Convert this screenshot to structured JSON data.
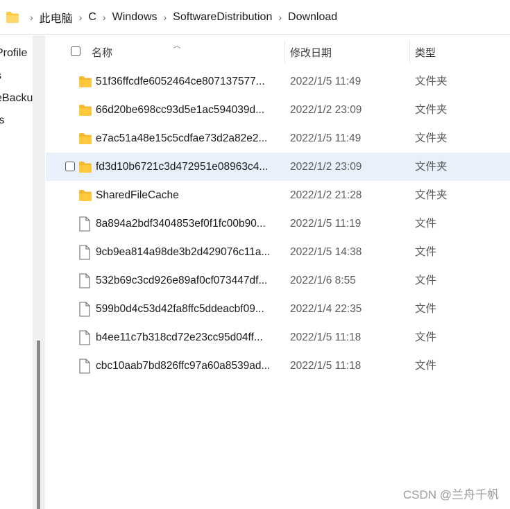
{
  "breadcrumb": {
    "items": [
      "此电脑",
      "C",
      "Windows",
      "SoftwareDistribution",
      "Download"
    ]
  },
  "nav": {
    "items": [
      "Profile",
      "s",
      "eBacku",
      "ts"
    ]
  },
  "header": {
    "name": "名称",
    "modified": "修改日期",
    "type": "类型"
  },
  "files": [
    {
      "name": "51f36ffcdfe6052464ce807137577...",
      "date": "2022/1/5 11:49",
      "type": "文件夹",
      "kind": "folder"
    },
    {
      "name": "66d20be698cc93d5e1ac594039d...",
      "date": "2022/1/2 23:09",
      "type": "文件夹",
      "kind": "folder"
    },
    {
      "name": "e7ac51a48e15c5cdfae73d2a82e2...",
      "date": "2022/1/5 11:49",
      "type": "文件夹",
      "kind": "folder"
    },
    {
      "name": "fd3d10b6721c3d472951e08963c4...",
      "date": "2022/1/2 23:09",
      "type": "文件夹",
      "kind": "folder",
      "hover": true
    },
    {
      "name": "SharedFileCache",
      "date": "2022/1/2 21:28",
      "type": "文件夹",
      "kind": "folder"
    },
    {
      "name": "8a894a2bdf3404853ef0f1fc00b90...",
      "date": "2022/1/5 11:19",
      "type": "文件",
      "kind": "file"
    },
    {
      "name": "9cb9ea814a98de3b2d429076c11a...",
      "date": "2022/1/5 14:38",
      "type": "文件",
      "kind": "file"
    },
    {
      "name": "532b69c3cd926e89af0cf073447df...",
      "date": "2022/1/6 8:55",
      "type": "文件",
      "kind": "file"
    },
    {
      "name": "599b0d4c53d42fa8ffc5ddeacbf09...",
      "date": "2022/1/4 22:35",
      "type": "文件",
      "kind": "file"
    },
    {
      "name": "b4ee11c7b318cd72e23cc95d04ff...",
      "date": "2022/1/5 11:18",
      "type": "文件",
      "kind": "file"
    },
    {
      "name": "cbc10aab7bd826ffc97a60a8539ad...",
      "date": "2022/1/5 11:18",
      "type": "文件",
      "kind": "file"
    }
  ],
  "watermark": "CSDN @兰舟千帆",
  "colors": {
    "folder": "#ffc83d",
    "hover_row": "#e8f1fb"
  }
}
